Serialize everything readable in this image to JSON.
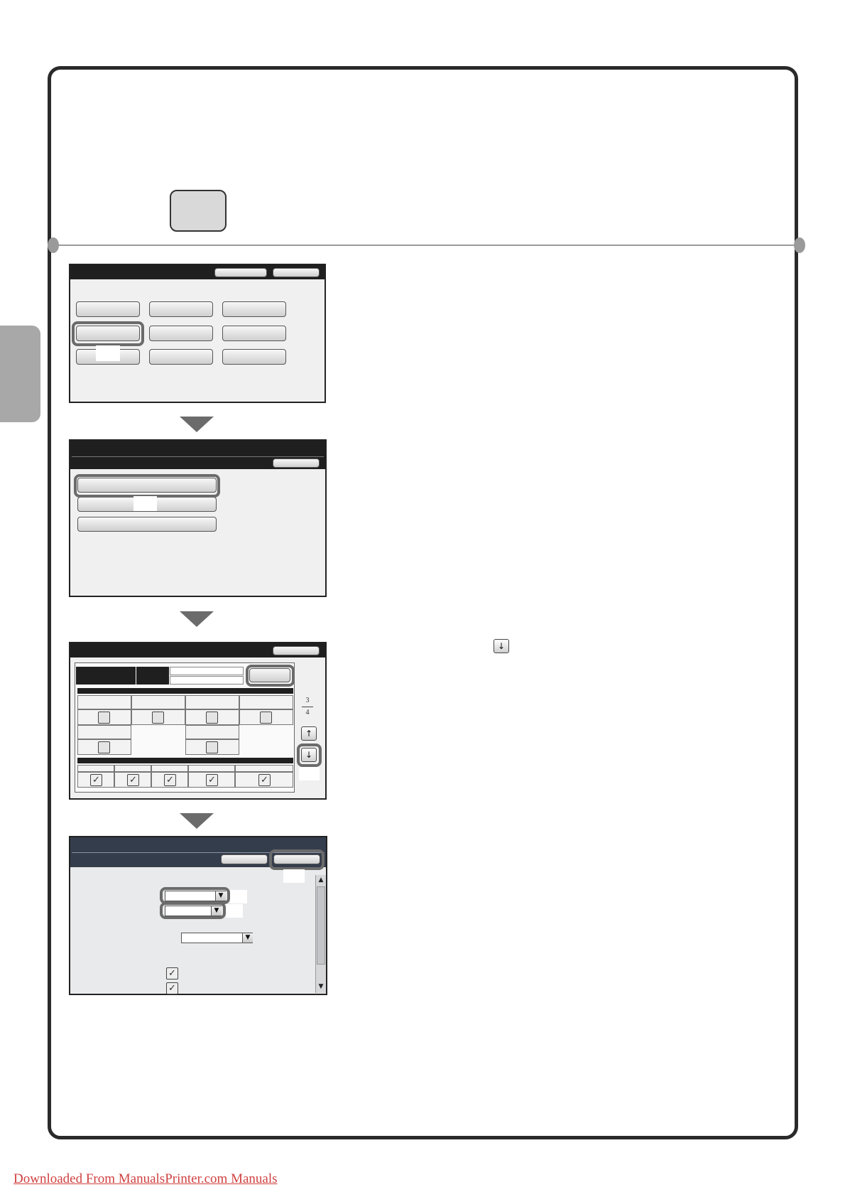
{
  "footer": {
    "link_text": "Downloaded From ManualsPrinter.com Manuals"
  },
  "screen3": {
    "page_current": "3",
    "page_total": "4"
  },
  "icons": {
    "scroll_up": "↑",
    "scroll_down": "↓",
    "checkmark": "✓",
    "dropdown": "▼",
    "scroll_up_triangle": "▲",
    "scroll_down_triangle": "▼"
  },
  "colors": {
    "frame": "#2a2a2a",
    "highlight": "#6b6b6b",
    "side_tab": "#a8a8a8",
    "footer_link": "#d04040",
    "screen4_titlebar": "#343d4c"
  }
}
